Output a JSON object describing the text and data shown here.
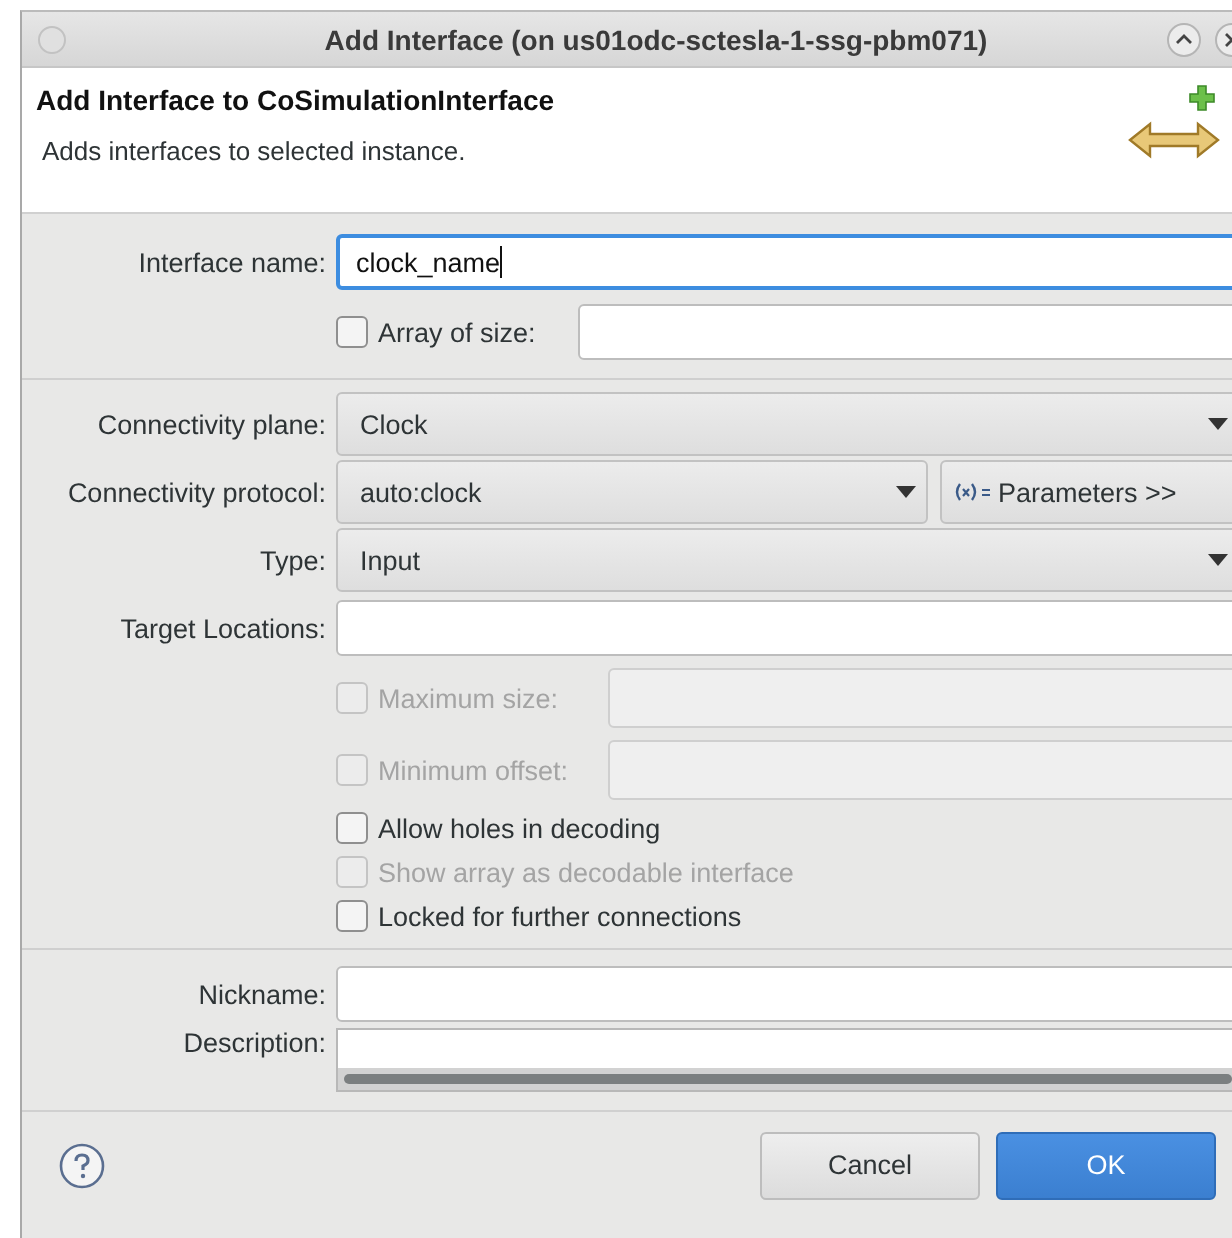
{
  "window": {
    "title": "Add Interface  (on us01odc-sctesla-1-ssg-pbm071)"
  },
  "header": {
    "title": "Add Interface to CoSimulationInterface",
    "description": "Adds interfaces to selected instance."
  },
  "sections": [
    {
      "rows": [
        {
          "kind": "text",
          "label": "Interface name:",
          "value": "clock_name",
          "focused": true
        },
        {
          "kind": "checkfield",
          "check": {
            "label": "Array of size:",
            "checked": false,
            "disabled": false
          }
        }
      ]
    },
    {
      "rows": [
        {
          "kind": "dropdown",
          "label": "Connectivity plane:",
          "value": "Clock"
        },
        {
          "kind": "dropdown_button",
          "label": "Connectivity protocol:",
          "value": "auto:clock",
          "button": "Parameters >>"
        },
        {
          "kind": "dropdown",
          "label": "Type:",
          "value": "Input"
        },
        {
          "kind": "text",
          "label": "Target Locations:",
          "focused": false
        },
        {
          "kind": "checkfield",
          "check": {
            "label": "Maximum size:",
            "checked": false,
            "disabled": true
          }
        },
        {
          "kind": "checkfield",
          "check": {
            "label": "Minimum offset:",
            "checked": false,
            "disabled": true
          }
        },
        {
          "kind": "check",
          "check": {
            "label": "Allow holes in decoding",
            "checked": false,
            "disabled": false
          }
        },
        {
          "kind": "check",
          "check": {
            "label": "Show array as decodable interface",
            "checked": false,
            "disabled": true
          }
        },
        {
          "kind": "check",
          "check": {
            "label": "Locked for further connections",
            "checked": false,
            "disabled": false
          }
        }
      ]
    },
    {
      "rows": [
        {
          "kind": "text",
          "label": "Nickname:",
          "focused": false
        },
        {
          "kind": "textarea",
          "label": "Description:"
        }
      ]
    }
  ],
  "buttons": [
    {
      "label": "Cancel",
      "primary": false
    },
    {
      "label": "OK",
      "primary": true
    }
  ]
}
